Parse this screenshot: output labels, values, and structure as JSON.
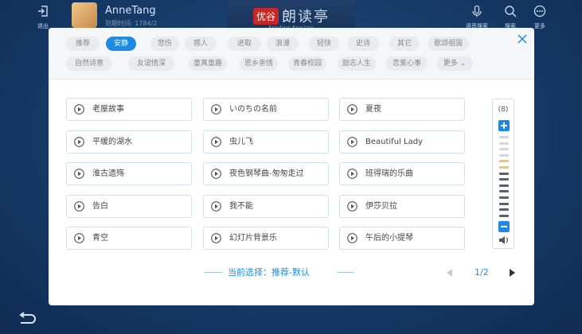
{
  "background": {
    "user_name": "AnneTang",
    "user_date": "到期时间: 1784/2",
    "logo_text": "朗读亭",
    "logo_badge": "优谷",
    "logo_sub": "Reading Pavilion",
    "left_button_label": "退出",
    "right_buttons": [
      "语音搜索",
      "搜索",
      "更多"
    ]
  },
  "tags": {
    "row1": [
      "推荐",
      "安静",
      "悲伤",
      "感人",
      "进取",
      "浪漫",
      "轻快",
      "史诗",
      "其它",
      "歌颂祖国"
    ],
    "row2": [
      "自然诗意",
      "友谊情深",
      "童真童趣",
      "思乡亲情",
      "青春校园",
      "励志人生",
      "恋爱心事",
      "更多"
    ],
    "active_index": 1
  },
  "songs": [
    "老屋故事",
    "いのちの名前",
    "夏夜",
    "平缓的湖水",
    "虫儿飞",
    "Beautiful Lady",
    "淮古遗殇",
    "夜色钢琴曲-匆匆走过",
    "班得瑞的乐曲",
    "告白",
    "我不能",
    "伊莎贝拉",
    "青空",
    "幻灯片背景乐",
    "午后的小提琴"
  ],
  "volume": {
    "count_label": "(8)",
    "level": 8,
    "max": 14
  },
  "footer": {
    "status": "当前选择：推荐-默认",
    "page": "1/2"
  },
  "colors": {
    "accent": "#1e8ae0",
    "tag_bg": "#e9ebee",
    "bg": "#163a68"
  }
}
